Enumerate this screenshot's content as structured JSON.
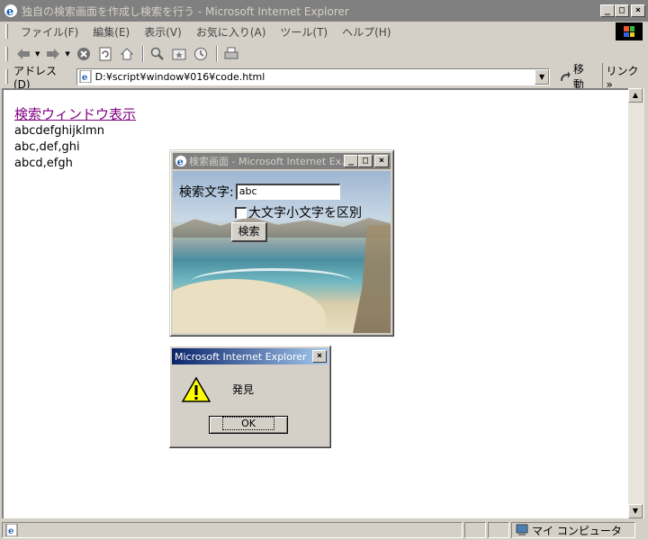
{
  "window": {
    "title": "独自の検索画面を作成し検索を行う - Microsoft Internet Explorer",
    "caption_buttons": [
      "_",
      "□",
      "×"
    ]
  },
  "menubar": {
    "items": [
      "ファイル(F)",
      "編集(E)",
      "表示(V)",
      "お気に入り(A)",
      "ツール(T)",
      "ヘルプ(H)"
    ]
  },
  "toolbar": {
    "icons": [
      "back-icon",
      "forward-icon",
      "stop-icon",
      "refresh-icon",
      "home-icon",
      "search-icon",
      "favorites-icon",
      "history-icon",
      "print-icon"
    ]
  },
  "address": {
    "label": "アドレス(D)",
    "url": "D:¥script¥window¥016¥code.html",
    "go_label": "移動",
    "links_label": "リンク »"
  },
  "page": {
    "link_text": "検索ウィンドウ表示",
    "lines": [
      "abcdefghijklmn",
      "abc,def,ghi",
      "abcd,efgh"
    ]
  },
  "popup": {
    "title": "検索画面 - Microsoft Internet Ex...",
    "search_label": "検索文字:",
    "search_value": "abc",
    "checkbox_label": "大文字小文字を区別",
    "checkbox_checked": false,
    "search_button": "検索"
  },
  "alert": {
    "title": "Microsoft Internet Explorer",
    "message": "発見",
    "ok_label": "OK"
  },
  "statusbar": {
    "zone": "マイ コンピュータ"
  },
  "colors": {
    "face": "#d4d0c8",
    "inactive_title": "#808080",
    "active_title": "#0a246a",
    "visited_link": "#800080"
  }
}
